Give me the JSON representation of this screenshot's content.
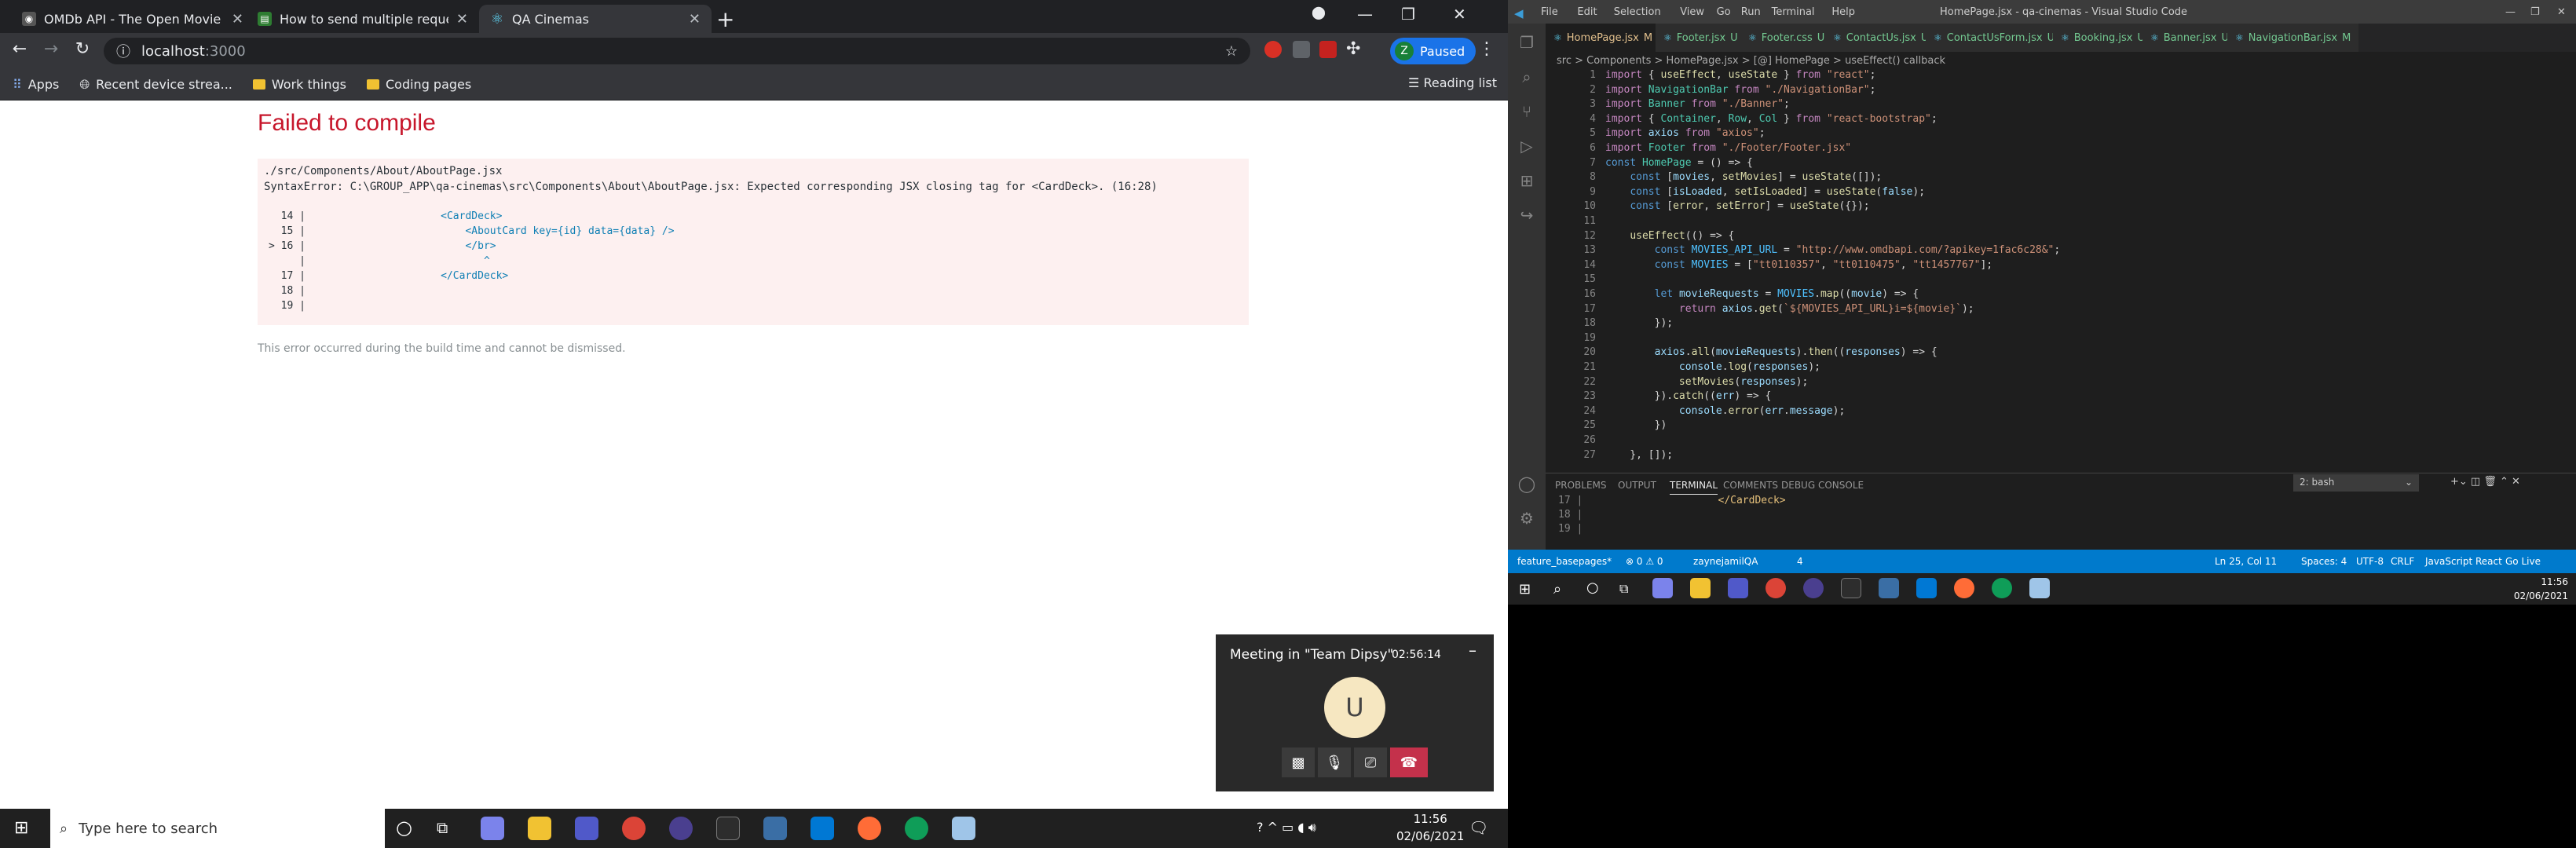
{
  "chrome": {
    "tabs": [
      {
        "title": "OMDb API - The Open Movie Da",
        "active": false
      },
      {
        "title": "How to send multiple requests u",
        "active": false
      },
      {
        "title": "QA Cinemas",
        "active": true
      }
    ],
    "url": "localhost",
    "url_port": ":3000",
    "profile_initial": "Z",
    "profile_label": "Paused",
    "bookmarks": [
      "Apps",
      "Recent device strea...",
      "Work things",
      "Coding pages"
    ],
    "reading_list": "Reading list"
  },
  "error_page": {
    "title": "Failed to compile",
    "file": "./src/Components/About/AboutPage.jsx",
    "message": "SyntaxError: C:\\GROUP_APP\\qa-cinemas\\src\\Components\\About\\AboutPage.jsx: Expected corresponding JSX closing tag for <CardDeck>. (16:28)",
    "code_lines": [
      {
        "num": "  14 |",
        "code": "                      <CardDeck>"
      },
      {
        "num": "  15 |",
        "code": "                          <AboutCard key={id} data={data} />"
      },
      {
        "num": "> 16 |",
        "code": "                          </br>"
      },
      {
        "num": "     |",
        "code": "                             ^"
      },
      {
        "num": "  17 |",
        "code": "                      </CardDeck>"
      },
      {
        "num": "  18 |",
        "code": ""
      },
      {
        "num": "  19 |",
        "code": ""
      }
    ],
    "footer": "This error occurred during the build time and cannot be dismissed."
  },
  "meeting": {
    "title": "Meeting in \"Team Dipsy\"",
    "time": "02:56:14",
    "avatar": "U"
  },
  "taskbar_left": {
    "search_placeholder": "Type here to search",
    "time": "11:56",
    "date": "02/06/2021"
  },
  "vscode": {
    "menu": [
      "File",
      "Edit",
      "Selection",
      "View",
      "Go",
      "Run",
      "Terminal",
      "Help"
    ],
    "window_title": "HomePage.jsx - qa-cinemas - Visual Studio Code",
    "tabs": [
      {
        "label": "HomePage.jsx",
        "badge": "M",
        "active": true
      },
      {
        "label": "Footer.jsx",
        "badge": "U",
        "active": false
      },
      {
        "label": "Footer.css",
        "badge": "U",
        "active": false
      },
      {
        "label": "ContactUs.jsx",
        "badge": "U",
        "active": false
      },
      {
        "label": "ContactUsForm.jsx",
        "badge": "U",
        "active": false
      },
      {
        "label": "Booking.jsx",
        "badge": "U",
        "active": false
      },
      {
        "label": "Banner.jsx",
        "badge": "U",
        "active": false
      },
      {
        "label": "NavigationBar.jsx",
        "badge": "M",
        "active": false
      }
    ],
    "breadcrumb": "src > Components > HomePage.jsx > [@] HomePage > useEffect() callback",
    "code": [
      "import { useEffect, useState } from \"react\";",
      "import NavigationBar from \"./NavigationBar\";",
      "import Banner from \"./Banner\";",
      "import { Container, Row, Col } from \"react-bootstrap\";",
      "import axios from \"axios\";",
      "import Footer from \"./Footer/Footer.jsx\"",
      "const HomePage = () => {",
      "    const [movies, setMovies] = useState([]);",
      "    const [isLoaded, setIsLoaded] = useState(false);",
      "    const [error, setError] = useState({});",
      "",
      "    useEffect(() => {",
      "        const MOVIES_API_URL = \"http://www.omdbapi.com/?apikey=1fac6c28&\";",
      "        const MOVIES = [\"tt0110357\", \"tt0110475\", \"tt1457767\"];",
      "",
      "        let movieRequests = MOVIES.map((movie) => {",
      "            return axios.get(`${MOVIES_API_URL}i=${movie}`);",
      "        });",
      "",
      "        axios.all(movieRequests).then((responses) => {",
      "            console.log(responses);",
      "            setMovies(responses);",
      "        }).catch((err) => {",
      "            console.error(err.message);",
      "        })",
      "",
      "    }, []);"
    ],
    "panel_tabs": [
      "PROBLEMS",
      "OUTPUT",
      "TERMINAL",
      "COMMENTS",
      "DEBUG CONSOLE"
    ],
    "active_panel": "TERMINAL",
    "terminal_select": "2: bash",
    "terminal_lines": [
      {
        "num": "17 |",
        "code": "                      </CardDeck>"
      },
      {
        "num": "18 |",
        "code": ""
      },
      {
        "num": "19 |",
        "code": ""
      }
    ],
    "status_left": [
      "feature_basepages*",
      "⊗ 0  ⚠ 0",
      "zaynejamilQA",
      "4"
    ],
    "status_right": [
      "Ln 25, Col 11",
      "Spaces: 4",
      "UTF-8",
      "CRLF",
      "JavaScript React",
      "Go Live"
    ]
  },
  "taskbar_right": {
    "time": "11:56",
    "date": "02/06/2021"
  }
}
